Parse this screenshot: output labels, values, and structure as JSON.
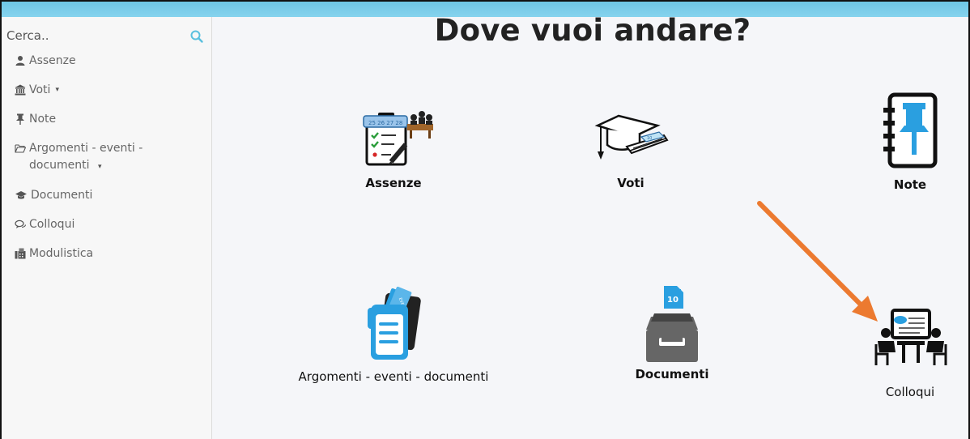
{
  "sidebar": {
    "search": {
      "placeholder": "Cerca.."
    },
    "items": [
      {
        "label": "Assenze",
        "icon": "user-icon"
      },
      {
        "label": "Voti",
        "icon": "bank-icon",
        "has_dropdown": true
      },
      {
        "label": "Note",
        "icon": "pushpin-icon"
      },
      {
        "label": "Argomenti - eventi - documenti",
        "icon": "folder-open-icon",
        "has_dropdown": true
      },
      {
        "label": "Documenti",
        "icon": "graduation-cap-icon"
      },
      {
        "label": "Colloqui",
        "icon": "chat-icon"
      },
      {
        "label": "Modulistica",
        "icon": "fax-icon"
      }
    ],
    "caret": "▾"
  },
  "main": {
    "title": "Dove vuoi andare?",
    "tiles": [
      {
        "label": "Assenze",
        "icon": "attendance-clipboard-icon"
      },
      {
        "label": "Voti",
        "icon": "graduation-cap-diploma-icon"
      },
      {
        "label": "Note",
        "icon": "notebook-pushpin-icon"
      },
      {
        "label": "Argomenti - eventi - documenti",
        "icon": "events-document-icon"
      },
      {
        "label": "Documenti",
        "icon": "inbox-tray-document-icon"
      },
      {
        "label": "Colloqui",
        "icon": "meeting-whiteboard-icon"
      }
    ]
  },
  "colors": {
    "topbar": "#7ccdea",
    "sidebar_bg": "#f7f7f7",
    "main_bg": "#f5f6f9",
    "accent_blue": "#2a9fe0",
    "annotation_arrow": "#ec7a30"
  }
}
